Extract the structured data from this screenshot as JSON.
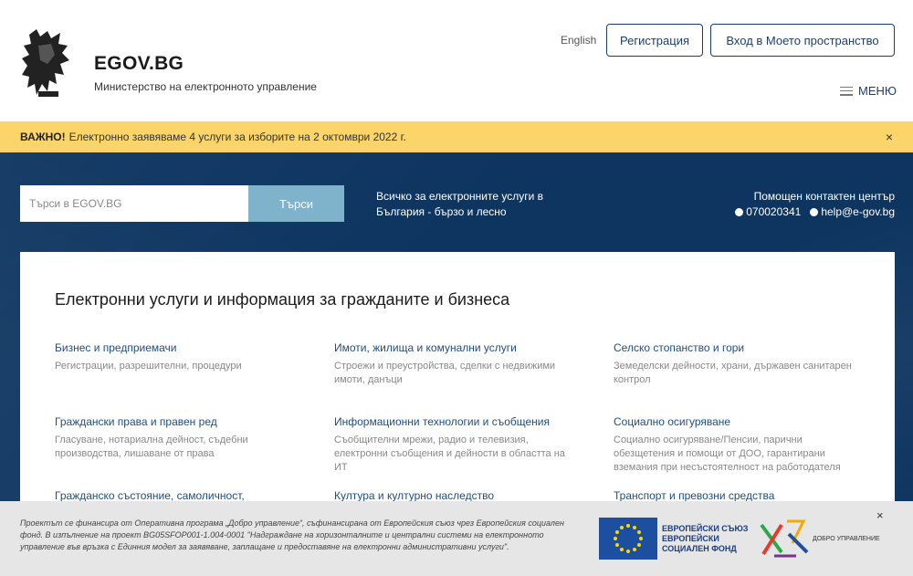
{
  "header": {
    "brand": "EGOV.BG",
    "subtitle": "Министерство на електронното управление",
    "lang": "English",
    "register": "Регистрация",
    "login": "Вход в Моето пространство",
    "menu": "МЕНЮ"
  },
  "notice": {
    "strong": "ВАЖНО!",
    "text": "Електронно заявяваме 4 услуги за изборите на 2 октомври 2022 г.",
    "close": "×"
  },
  "hero": {
    "search_placeholder": "Търси в EGOV.BG",
    "search_button": "Търси",
    "tagline": "Всичко за електронните услуги в България - бързо и лесно",
    "help_title": "Помощен контактен център",
    "help_phone": "070020341",
    "help_email": "help@e-gov.bg"
  },
  "main": {
    "title": "Електронни услуги и информация за гражданите и бизнеса",
    "services": [
      {
        "title": "Бизнес и предприемачи",
        "desc": "Регистрации, разрешителни, процедури"
      },
      {
        "title": "Имоти, жилища и комунални услуги",
        "desc": "Строежи и преустройства, сделки с недвижими имоти, данъци"
      },
      {
        "title": "Селско стопанство и гори",
        "desc": "Земеделски дейности, храни, държавен санитарен контрол"
      },
      {
        "title": "Граждански права и правен ред",
        "desc": "Гласуване, нотариална дейност, съдебни производства, лишаване от права"
      },
      {
        "title": "Информационни технологии и съобщения",
        "desc": "Съобщителни мрежи, радио и телевизия, електронни съобщения и дейности в областта на ИТ"
      },
      {
        "title": "Социално осигуряване",
        "desc": "Социално осигуряване/Пенсии, парични обезщетения и помощи от ДОО, гарантирани вземания при несъстоятелност на работодателя"
      },
      {
        "title": "Гражданско състояние, самоличност,",
        "desc": ""
      },
      {
        "title": "Култура и културно наследство",
        "desc": ""
      },
      {
        "title": "Транспорт и превозни средства",
        "desc": ""
      }
    ]
  },
  "footer": {
    "text": "Проектът се финансира от Оперативна програма „Добро управление“, съфинансирана от Европейския съюз чрез Европейския социален фонд. В изпълнение на проект BG05SFOP001-1.004-0001 \"Надграждане на хоризонталните и централни системи на електронното управление във връзка с Единния модел за заявяване, заплащане и предоставяне на електронни административни услуги\".",
    "eu_line1": "ЕВРОПЕЙСКИ СЪЮЗ",
    "eu_line2": "ЕВРОПЕЙСКИ",
    "eu_line3": "СОЦИАЛЕН ФОНД",
    "gov_label": "ДОБРО УПРАВЛЕНИЕ",
    "close": "×"
  }
}
